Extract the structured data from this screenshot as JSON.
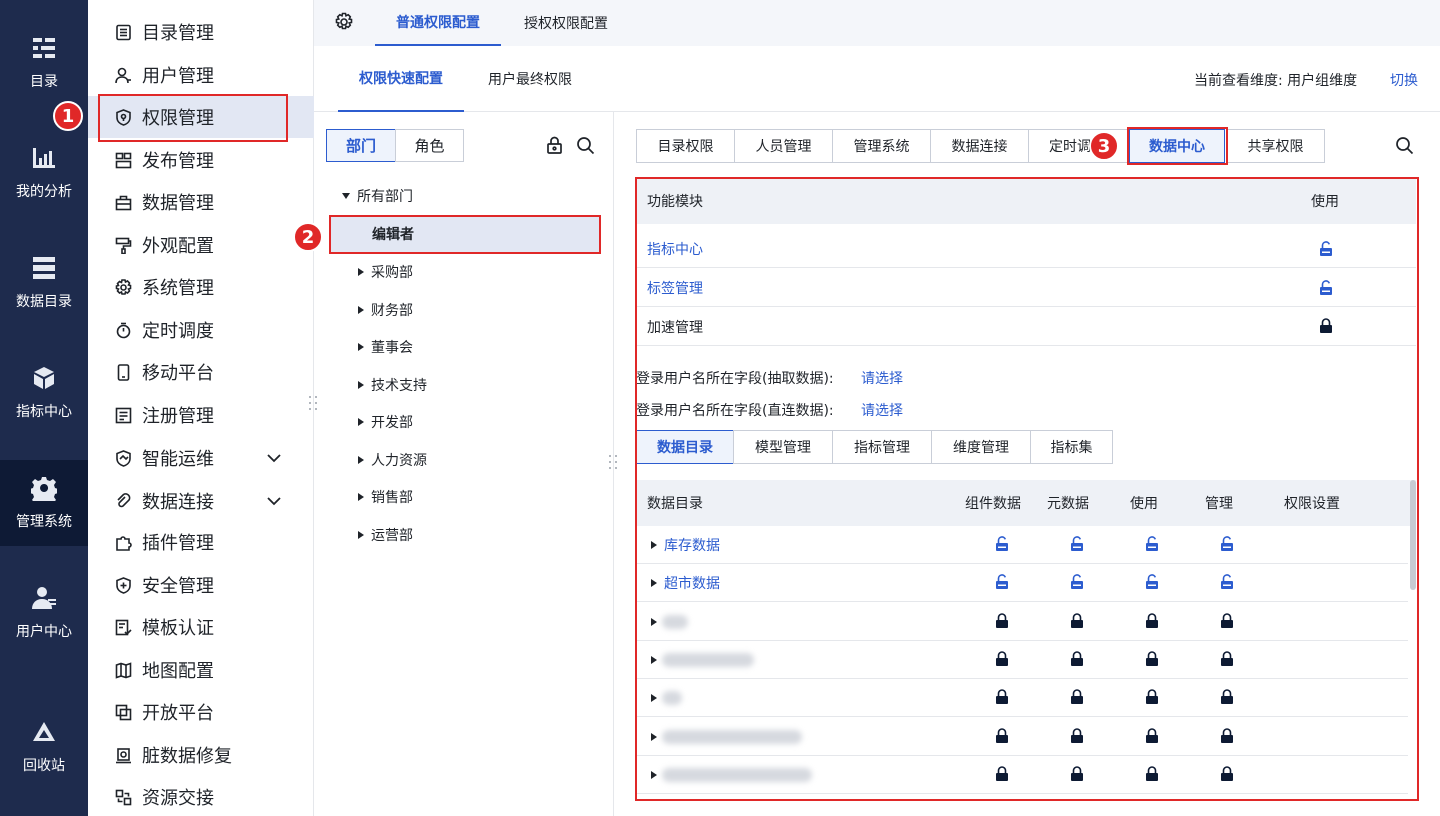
{
  "rail": {
    "items": [
      {
        "label": "目录",
        "icon": "catalog-icon"
      },
      {
        "label": "我的分析",
        "icon": "analysis-chart-icon"
      },
      {
        "label": "数据目录",
        "icon": "data-catalog-icon"
      },
      {
        "label": "指标中心",
        "icon": "cube-icon"
      },
      {
        "label": "管理系统",
        "icon": "management-gear-icon"
      },
      {
        "label": "用户中心",
        "icon": "user-icon"
      },
      {
        "label": "回收站",
        "icon": "recycle-icon"
      }
    ]
  },
  "menu": {
    "items": [
      {
        "label": "目录管理",
        "icon": "list-icon"
      },
      {
        "label": "用户管理",
        "icon": "user-manage-icon"
      },
      {
        "label": "权限管理",
        "icon": "shield-icon"
      },
      {
        "label": "发布管理",
        "icon": "publish-icon"
      },
      {
        "label": "数据管理",
        "icon": "data-manage-icon"
      },
      {
        "label": "外观配置",
        "icon": "brush-icon"
      },
      {
        "label": "系统管理",
        "icon": "settings-icon"
      },
      {
        "label": "定时调度",
        "icon": "timer-icon"
      },
      {
        "label": "移动平台",
        "icon": "mobile-icon"
      },
      {
        "label": "注册管理",
        "icon": "register-icon"
      },
      {
        "label": "智能运维",
        "icon": "ops-icon"
      },
      {
        "label": "数据连接",
        "icon": "link-icon"
      },
      {
        "label": "插件管理",
        "icon": "plugin-icon"
      },
      {
        "label": "安全管理",
        "icon": "security-icon"
      },
      {
        "label": "模板认证",
        "icon": "template-icon"
      },
      {
        "label": "地图配置",
        "icon": "map-icon"
      },
      {
        "label": "开放平台",
        "icon": "open-platform-icon"
      },
      {
        "label": "脏数据修复",
        "icon": "repair-icon"
      },
      {
        "label": "资源交接",
        "icon": "handover-icon"
      }
    ]
  },
  "top_tabs": [
    "普通权限配置",
    "授权权限配置"
  ],
  "sub_tabs": [
    "权限快速配置",
    "用户最终权限"
  ],
  "dimension": {
    "label": "当前查看维度: 用户组维度",
    "switch": "切换"
  },
  "dept_panel": {
    "segments": [
      "部门",
      "角色"
    ],
    "root": "所有部门",
    "selected": "编辑者",
    "children": [
      "采购部",
      "财务部",
      "董事会",
      "技术支持",
      "开发部",
      "人力资源",
      "销售部",
      "运营部"
    ]
  },
  "perm_tabs": [
    "目录权限",
    "人员管理",
    "管理系统",
    "数据连接",
    "定时调",
    "数据中心",
    "共享权限"
  ],
  "module_table": {
    "headers": [
      "功能模块",
      "使用"
    ],
    "rows": [
      {
        "name": "指标中心",
        "state": "unlocked"
      },
      {
        "name": "标签管理",
        "state": "unlocked"
      },
      {
        "name": "加速管理",
        "state": "locked"
      }
    ]
  },
  "fields": [
    {
      "label": "登录用户名所在字段(抽取数据):",
      "value": "请选择"
    },
    {
      "label": "登录用户名所在字段(直连数据):",
      "value": "请选择"
    }
  ],
  "data_tabs": [
    "数据目录",
    "模型管理",
    "指标管理",
    "维度管理",
    "指标集"
  ],
  "catalog_table": {
    "headers": [
      "数据目录",
      "组件数据",
      "元数据",
      "使用",
      "管理",
      "权限设置"
    ],
    "rows": [
      {
        "name": "库存数据",
        "state": "unlocked"
      },
      {
        "name": "超市数据",
        "state": "unlocked"
      },
      {
        "name": "",
        "state": "locked"
      },
      {
        "name": "",
        "state": "locked"
      },
      {
        "name": "",
        "state": "locked"
      },
      {
        "name": "",
        "state": "locked"
      },
      {
        "name": "",
        "state": "locked"
      }
    ]
  },
  "badges": [
    "1",
    "2",
    "3"
  ],
  "colors": {
    "accent": "#2c5ccf",
    "rail": "#1e2b4d",
    "annotation": "#e02828"
  }
}
